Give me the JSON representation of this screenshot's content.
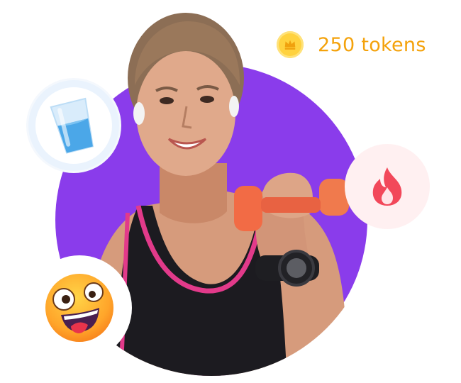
{
  "tokens": {
    "amount_label": "250 tokens"
  },
  "icons": {
    "coin": "coin-crown-icon",
    "water": "water-glass-icon",
    "fire": "fire-icon",
    "emoji": "crazy-face-emoji-icon"
  },
  "colors": {
    "purple": "#8A3CEB",
    "token_text": "#F4A20B",
    "coin": "#FFD23F",
    "fire": "#F2485A",
    "water": "#4BA7E8"
  }
}
